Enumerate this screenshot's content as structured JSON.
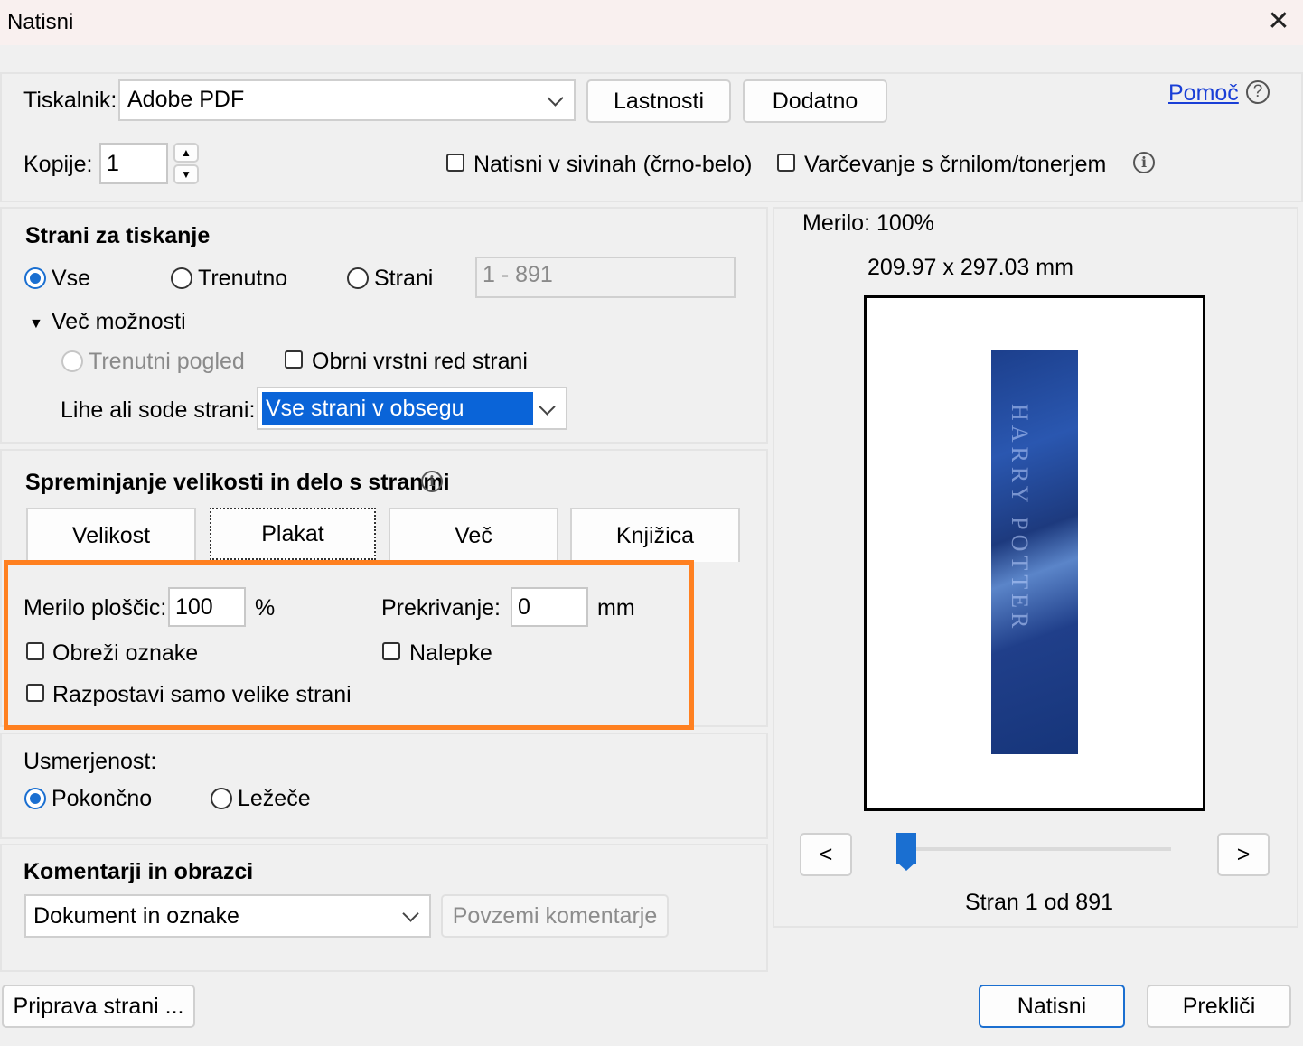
{
  "window": {
    "title": "Natisni",
    "close": "✕"
  },
  "printer": {
    "label": "Tiskalnik:",
    "value": "Adobe PDF",
    "properties_btn": "Lastnosti",
    "advanced_btn": "Dodatno",
    "help_link": "Pomoč"
  },
  "copies": {
    "label": "Kopije:",
    "value": "1",
    "grayscale": "Natisni v sivinah (črno-belo)",
    "grayscale_checked": false,
    "save_ink": "Varčevanje s črnilom/tonerjem",
    "save_ink_checked": false
  },
  "pages": {
    "heading": "Strani za tiskanje",
    "all": "Vse",
    "current": "Trenutno",
    "range": "Strani",
    "range_value": "1 - 891",
    "selected": "Vse",
    "more_options": "Več možnosti",
    "current_view": "Trenutni pogled",
    "reverse": "Obrni vrstni red strani",
    "odd_even_label": "Lihe ali sode strani:",
    "odd_even_value": "Vse strani v obsegu"
  },
  "sizing": {
    "heading": "Spreminjanje velikosti in delo s stranmi",
    "tabs": [
      "Velikost",
      "Plakat",
      "Več",
      "Knjižica"
    ],
    "active_tab": "Plakat",
    "tile_scale_label": "Merilo ploščic:",
    "tile_scale_value": "100",
    "tile_scale_unit": "%",
    "overlap_label": "Prekrivanje:",
    "overlap_value": "0",
    "overlap_unit": "mm",
    "cut_marks": "Obreži oznake",
    "labels": "Nalepke",
    "tile_large_only": "Razpostavi samo velike strani"
  },
  "orientation": {
    "heading": "Usmerjenost:",
    "portrait": "Pokončno",
    "landscape": "Ležeče",
    "selected": "Pokončno"
  },
  "comments": {
    "heading": "Komentarji in obrazci",
    "value": "Dokument in oznake",
    "summarize_btn": "Povzemi komentarje"
  },
  "preview": {
    "scale": "Merilo: 100%",
    "size": "209.97 x 297.03 mm",
    "prev": "<",
    "next": ">",
    "page_status": "Stran 1 od 891",
    "current_page": 1,
    "total_pages": 891
  },
  "footer": {
    "page_setup_btn": "Priprava strani ...",
    "print_btn": "Natisni",
    "cancel_btn": "Prekliči"
  },
  "colors": {
    "accent": "#1a6fd1",
    "highlight": "#ff8020",
    "selection": "#0a64d8"
  }
}
